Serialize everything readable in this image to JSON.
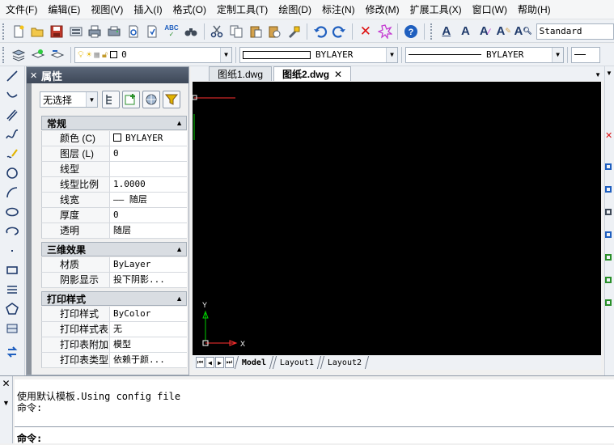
{
  "menu": [
    "文件(F)",
    "编辑(E)",
    "视图(V)",
    "插入(I)",
    "格式(O)",
    "定制工具(T)",
    "绘图(D)",
    "标注(N)",
    "修改(M)",
    "扩展工具(X)",
    "窗口(W)",
    "帮助(H)"
  ],
  "toolbar1": {
    "icons": [
      "new-file-icon",
      "open-folder-icon",
      "save-icon",
      "print-preview-icon",
      "print-icon",
      "plot-icon",
      "page-preview-icon",
      "publish-icon",
      "spellcheck-icon",
      "find-binoculars-icon",
      "cut-icon",
      "copy-icon",
      "paste-icon",
      "paste-special-icon",
      "match-properties-icon",
      "undo-icon",
      "redo-icon",
      "erase-icon",
      "explode-icon",
      "help-icon",
      "text-style-a-icon",
      "text-a-icon",
      "text-edit-icon",
      "text-scale-icon",
      "text-find-icon"
    ],
    "spell_label": "ABC",
    "text_style": "Standard"
  },
  "toolbar2": {
    "layer_value": "0",
    "linetype_value": "BYLAYER",
    "lineweight_value": "BYLAYER"
  },
  "properties": {
    "title": "属性",
    "selection": "无选择",
    "sections": [
      {
        "title": "常规",
        "rows": [
          {
            "k": "颜色 (C)",
            "v": "BYLAYER"
          },
          {
            "k": "图层 (L)",
            "v": "0"
          },
          {
            "k": "线型",
            "v": ""
          },
          {
            "k": "线型比例",
            "v": "1.0000"
          },
          {
            "k": "线宽",
            "v": "—— 随层"
          },
          {
            "k": "厚度",
            "v": "0"
          },
          {
            "k": "透明",
            "v": "随层"
          }
        ]
      },
      {
        "title": "三维效果",
        "rows": [
          {
            "k": "材质",
            "v": "ByLayer"
          },
          {
            "k": "阴影显示",
            "v": "投下阴影..."
          }
        ]
      },
      {
        "title": "打印样式",
        "rows": [
          {
            "k": "打印样式",
            "v": "ByColor"
          },
          {
            "k": "打印样式表",
            "v": "无"
          },
          {
            "k": "打印表附加到",
            "v": "模型"
          },
          {
            "k": "打印表类型",
            "v": "依赖于颜..."
          }
        ]
      }
    ]
  },
  "drawing_tabs": [
    {
      "label": "图纸1.dwg",
      "active": false
    },
    {
      "label": "图纸2.dwg",
      "active": true
    }
  ],
  "ucs": {
    "x_label": "X",
    "y_label": "Y"
  },
  "layout_tabs": [
    "Model",
    "Layout1",
    "Layout2"
  ],
  "command": {
    "history": [
      "使用默认模板.Using config file",
      "命令:"
    ],
    "prompt": "命令:"
  },
  "colors": {
    "canvas": "#000000",
    "crosshair": "#ff0000",
    "ucs_x": "#ff0000",
    "ucs_y": "#00cc00",
    "accent": "#1f5fbf"
  }
}
